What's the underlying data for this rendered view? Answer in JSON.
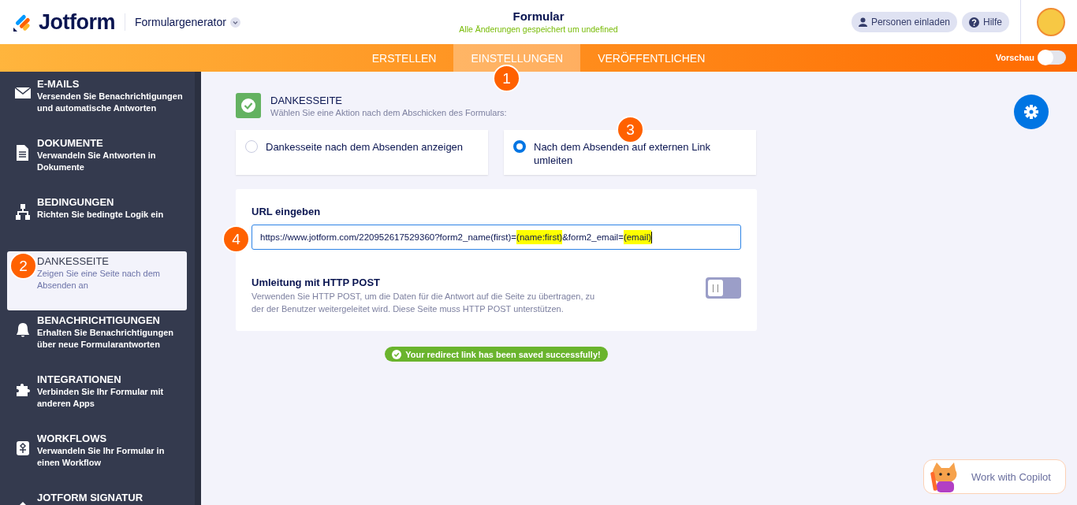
{
  "header": {
    "logo": "Jotform",
    "product": "Formulargenerator",
    "title": "Formular",
    "save_status": "Alle Änderungen gespeichert um undefined",
    "buttons": [
      {
        "kind": "invite",
        "label": "Personen einladen"
      },
      {
        "kind": "help",
        "label": "Hilfe"
      }
    ]
  },
  "nav": {
    "tabs": [
      {
        "label": "ERSTELLEN",
        "selected": false
      },
      {
        "label": "EINSTELLUNGEN",
        "selected": true
      },
      {
        "label": "VERÖFFENTLICHEN",
        "selected": false
      }
    ],
    "preview": {
      "label": "Vorschau",
      "on": false
    }
  },
  "sidebar": {
    "items": [
      {
        "kind": "mail",
        "title": "E-MAILS",
        "description": "Versenden Sie Benachrichtigungen und automatische Antworten",
        "selected": false
      },
      {
        "kind": "document",
        "title": "DOKUMENTE",
        "description": "Verwandeln Sie Antworten in Dokumente",
        "selected": false
      },
      {
        "kind": "logic",
        "title": "BEDINGUNGEN",
        "description": "Richten Sie bedingte Logik ein",
        "selected": false
      },
      {
        "kind": "page",
        "title": "DANKESSEITE",
        "description": "Zeigen Sie eine Seite nach dem Absenden an",
        "selected": true
      },
      {
        "kind": "bell",
        "title": "BENACHRICHTIGUNGEN",
        "description": "Erhalten Sie Benachrichtigungen über neue Formularantworten",
        "selected": false
      },
      {
        "kind": "puzzle",
        "title": "INTEGRATIONEN",
        "description": "Verbinden Sie Ihr Formular mit anderen Apps",
        "selected": false
      },
      {
        "kind": "workflow",
        "title": "WORKFLOWS",
        "description": "Verwandeln Sie Ihr Formular in einen Workflow",
        "selected": false
      },
      {
        "kind": "sign",
        "title": "JOTFORM SIGNATUR",
        "selected": false
      }
    ]
  },
  "section": {
    "title": "DANKESSEITE",
    "subtitle": "Wählen Sie eine Aktion nach dem Abschicken des Formulars:",
    "options": [
      {
        "label": "Dankesseite nach dem Absenden anzeigen",
        "selected": false
      },
      {
        "label": "Nach dem Absenden auf externen Link umleiten",
        "selected": true
      }
    ],
    "url": {
      "label": "URL eingeben",
      "segments": [
        {
          "text": "https://www.jotform.com/220952617529360?form2_name(first)=",
          "highlighted": false
        },
        {
          "text": "(name:first)",
          "highlighted": true
        },
        {
          "text": "&form2_email=",
          "highlighted": false
        },
        {
          "text": "(email)",
          "highlighted": true
        }
      ]
    },
    "post": {
      "title": "Umleitung mit HTTP POST",
      "description": "Verwenden Sie HTTP POST, um die Daten für die Antwort auf die Seite zu übertragen, zu der der Benutzer weitergeleitet wird. Diese Seite muss HTTP POST unterstützen.",
      "on": false
    },
    "toast": "Your redirect link has been saved successfully!"
  },
  "copilot": {
    "label": "Work with Copilot"
  },
  "annotations": [
    "1",
    "2",
    "3",
    "4"
  ]
}
